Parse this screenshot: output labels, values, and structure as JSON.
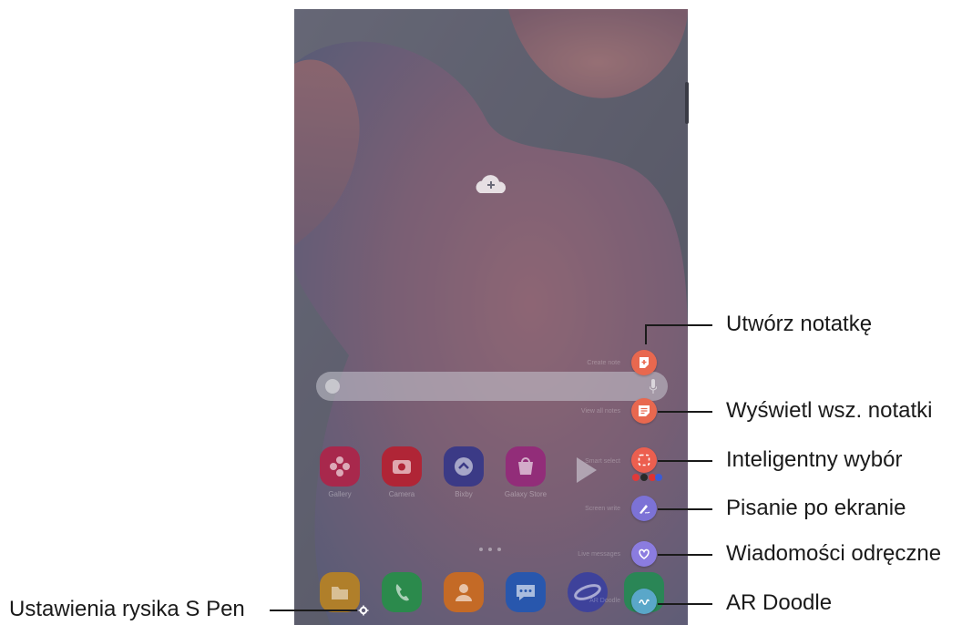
{
  "annotations": {
    "create_note": "Utwórz notatkę",
    "view_all_notes": "Wyświetl wsz. notatki",
    "smart_select": "Inteligentny wybór",
    "screen_write": "Pisanie po ekranie",
    "live_messages": "Wiadomości odręczne",
    "ar_doodle": "AR Doodle",
    "s_pen_settings": "Ustawienia rysika S Pen"
  },
  "air_command_menu": {
    "items": [
      {
        "label": "Create note",
        "color": "#e8684f",
        "icon": "note-plus-icon"
      },
      {
        "label": "View all notes",
        "color": "#e8684f",
        "icon": "notes-list-icon"
      },
      {
        "label": "Smart select",
        "color": "#ec5f4f",
        "icon": "smart-select-icon"
      },
      {
        "label": "Screen write",
        "color": "#7c72d6",
        "icon": "pen-write-icon"
      },
      {
        "label": "Live messages",
        "color": "#8b7ce0",
        "icon": "heart-icon"
      },
      {
        "label": "AR Doodle",
        "color": "#5aa7c9",
        "icon": "ar-doodle-icon"
      }
    ]
  },
  "home_apps": [
    {
      "label": "Gallery",
      "color": "#c2264f"
    },
    {
      "label": "Camera",
      "color": "#c9243d"
    },
    {
      "label": "Bixby",
      "color": "#3f3f9c"
    },
    {
      "label": "Galaxy Store",
      "color": "#a82b86"
    },
    {
      "label": "Play Store",
      "color": "#e8e8e8"
    }
  ],
  "dock_apps": [
    {
      "label": "My Files",
      "color": "#d69a2e"
    },
    {
      "label": "Phone",
      "color": "#2e9b55"
    },
    {
      "label": "Contacts",
      "color": "#e07a2a"
    },
    {
      "label": "Messages",
      "color": "#2f64c9"
    },
    {
      "label": "Internet",
      "color": "#4b4fb8"
    },
    {
      "label": "Calendar",
      "color": "#2f9b63"
    }
  ]
}
